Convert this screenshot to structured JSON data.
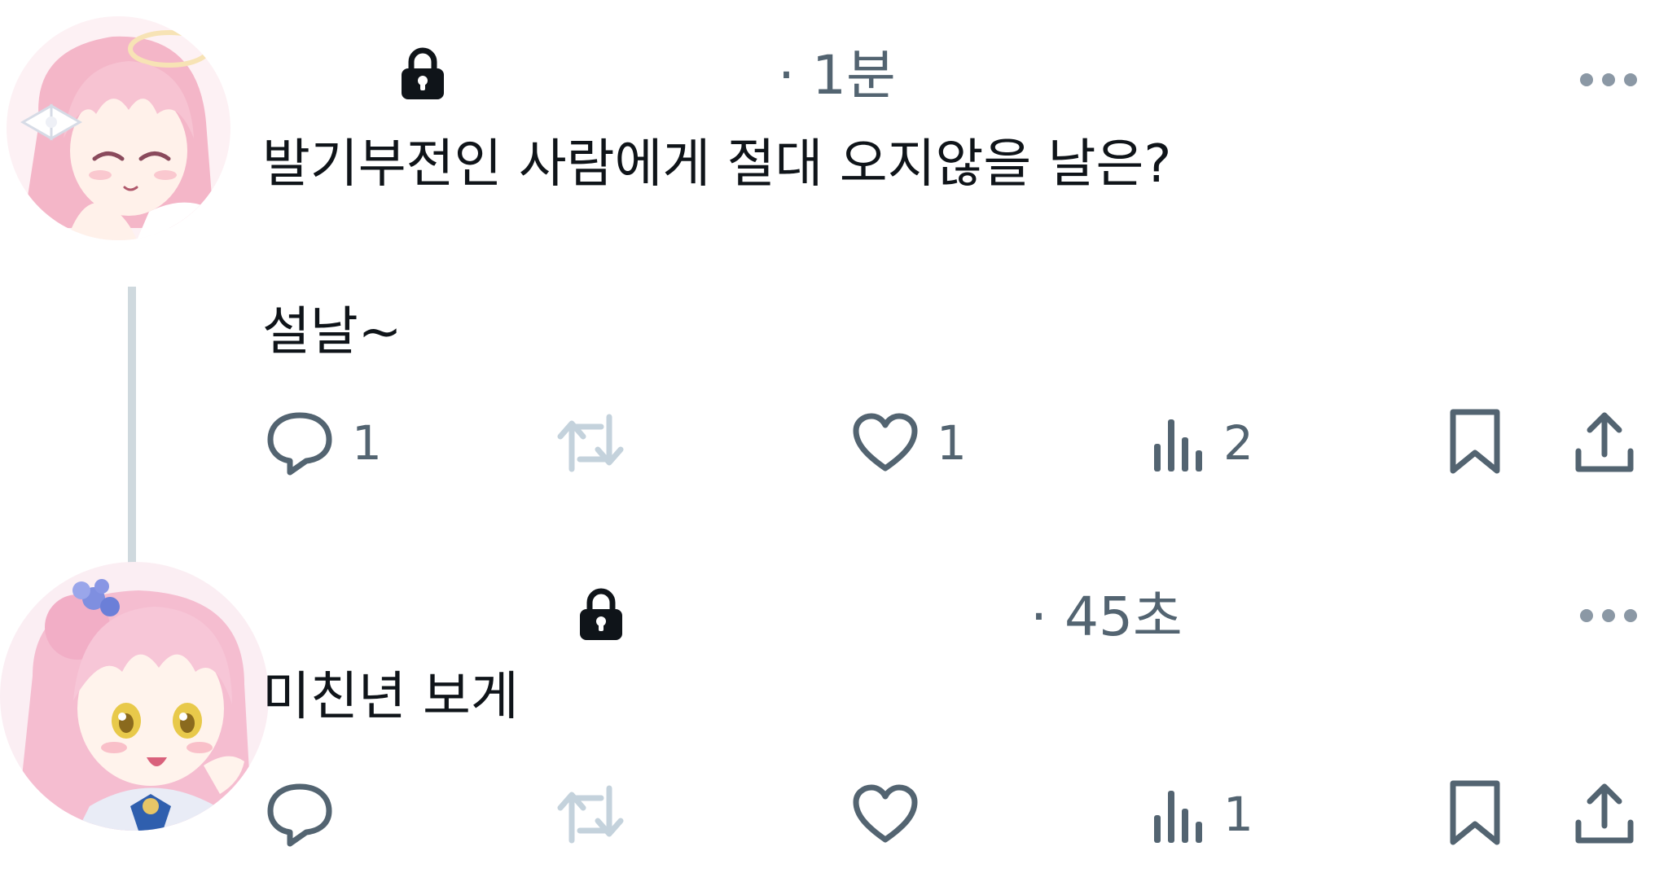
{
  "posts": [
    {
      "timestamp": "· 1분",
      "text_line1": "발기부전인 사람에게 절대 오지않을 날은?",
      "text_line2": "설날~",
      "actions": {
        "reply_count": "1",
        "retweet_count": "",
        "like_count": "1",
        "views_count": "2"
      }
    },
    {
      "timestamp": "· 45초",
      "text_line1": "미친년 보게",
      "actions": {
        "reply_count": "",
        "retweet_count": "",
        "like_count": "",
        "views_count": "1"
      }
    }
  ],
  "colors": {
    "text": "#0f1419",
    "secondary": "#536471",
    "retweet_disabled": "#c4d2dc",
    "thread_line": "#cfd9de",
    "avatar_hair_pink": "#f4b6c8"
  }
}
